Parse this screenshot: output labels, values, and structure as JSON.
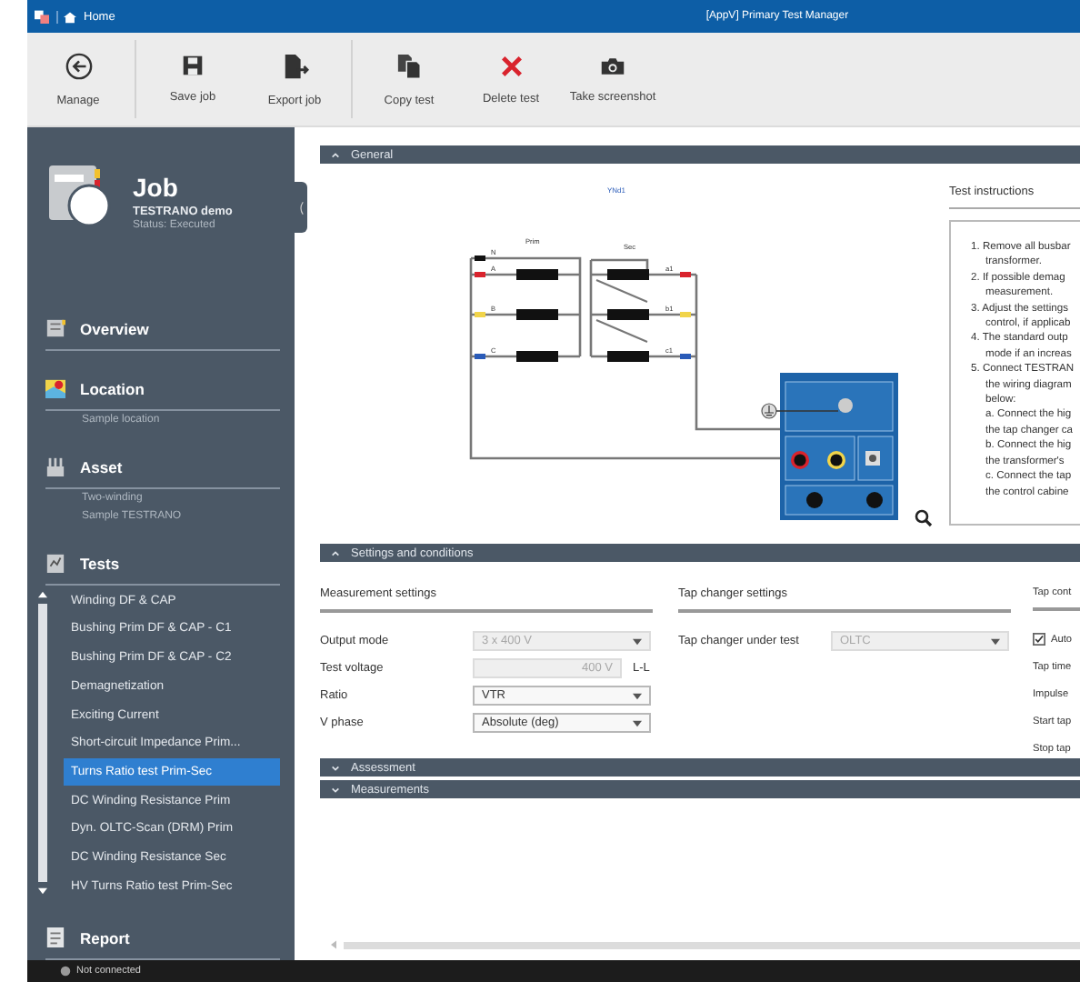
{
  "window": {
    "home": "Home",
    "title": "[AppV] Primary Test Manager"
  },
  "toolbar": [
    {
      "label": "Manage",
      "kind": "back"
    },
    {
      "label": "Save job",
      "kind": "save"
    },
    {
      "label": "Export job",
      "kind": "export"
    },
    {
      "label": "Copy test",
      "kind": "copy"
    },
    {
      "label": "Delete test",
      "kind": "delete"
    },
    {
      "label": "Take screenshot",
      "kind": "camera"
    }
  ],
  "job": {
    "title": "Job",
    "name": "TESTRANO demo",
    "status": "Status: Executed"
  },
  "sidebar": {
    "sections": [
      {
        "label": "Overview",
        "kind": "overview"
      },
      {
        "label": "Location",
        "kind": "location",
        "details": [
          "Sample location"
        ]
      },
      {
        "label": "Asset",
        "kind": "asset",
        "details": [
          "Two-winding",
          "Sample TESTRANO"
        ]
      },
      {
        "label": "Tests",
        "kind": "tests",
        "items": [
          {
            "label": "Winding DF & CAP",
            "selected": false
          },
          {
            "label": "Bushing Prim DF & CAP - C1",
            "selected": false
          },
          {
            "label": "Bushing Prim DF & CAP - C2",
            "selected": false
          },
          {
            "label": "Demagnetization",
            "selected": false
          },
          {
            "label": "Exciting Current",
            "selected": false
          },
          {
            "label": "Short-circuit Impedance Prim...",
            "selected": false
          },
          {
            "label": "Turns Ratio test Prim-Sec",
            "selected": true
          },
          {
            "label": "DC Winding Resistance Prim",
            "selected": false
          },
          {
            "label": "Dyn. OLTC-Scan (DRM) Prim",
            "selected": false
          },
          {
            "label": "DC Winding Resistance Sec",
            "selected": false
          },
          {
            "label": "HV Turns Ratio test Prim-Sec",
            "selected": false
          }
        ]
      },
      {
        "label": "Report",
        "kind": "report"
      }
    ]
  },
  "general": {
    "title": "General",
    "expanded": true,
    "diagram": {
      "vector_group": "YNd1",
      "prim_label": "Prim",
      "sec_label": "Sec",
      "prim_terminals": [
        "N",
        "A",
        "B",
        "C"
      ],
      "sec_terminals": [
        "a1",
        "b1",
        "c1"
      ]
    },
    "instructions": {
      "title": "Test instructions",
      "steps": [
        {
          "kind": "step",
          "lines": [
            "1. Remove all busbar",
            "transformer."
          ]
        },
        {
          "kind": "step",
          "lines": [
            "2. If possible demag",
            "measurement."
          ]
        },
        {
          "kind": "step",
          "lines": [
            "3. Adjust the settings",
            "control, if applicab"
          ]
        },
        {
          "kind": "step",
          "lines": [
            "4. The standard outp",
            "mode if an increas"
          ]
        },
        {
          "kind": "step",
          "lines": [
            "5. Connect TESTRAN",
            "the wiring diagram",
            "below:"
          ]
        },
        {
          "kind": "sub",
          "lines": [
            "a. Connect the hig",
            "the tap changer ca"
          ]
        },
        {
          "kind": "sub",
          "lines": [
            "b. Connect the hig",
            "the transformer's"
          ]
        },
        {
          "kind": "sub",
          "lines": [
            "c. Connect the tap",
            "the control cabine"
          ]
        }
      ]
    }
  },
  "settings": {
    "title": "Settings and conditions",
    "expanded": true,
    "groups": [
      {
        "title": "Measurement settings",
        "rows": [
          {
            "label": "Output mode",
            "kind": "dropdown",
            "value": "3 x 400 V",
            "disabled": true
          },
          {
            "label": "Test voltage",
            "kind": "number",
            "value": "400 V",
            "unit": "L-L",
            "disabled": true
          },
          {
            "label": "Ratio",
            "kind": "dropdown",
            "value": "VTR",
            "disabled": false
          },
          {
            "label": "V phase",
            "kind": "dropdown",
            "value": "Absolute (deg)",
            "disabled": false
          }
        ]
      },
      {
        "title": "Tap changer settings",
        "rows": [
          {
            "label": "Tap changer under test",
            "kind": "dropdown",
            "value": "OLTC",
            "disabled": true
          }
        ]
      },
      {
        "title": "Tap cont",
        "rows": [
          {
            "label": "Auto",
            "kind": "checkbox",
            "checked": true
          },
          {
            "label": "Tap time",
            "kind": "label"
          },
          {
            "label": "Impulse",
            "kind": "label"
          },
          {
            "label": "Start tap",
            "kind": "label"
          },
          {
            "label": "Stop tap",
            "kind": "label"
          }
        ]
      }
    ]
  },
  "collapsed_sections": [
    {
      "title": "Assessment",
      "expanded": false
    },
    {
      "title": "Measurements",
      "expanded": false
    }
  ],
  "status_bar": {
    "text": "Not connected"
  }
}
